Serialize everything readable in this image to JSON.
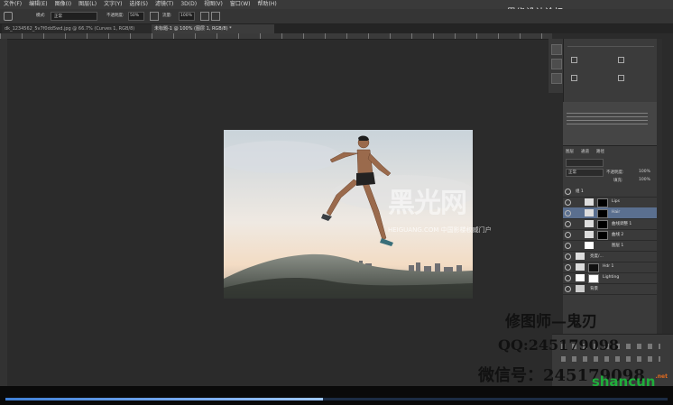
{
  "menu": {
    "items": [
      "文件(F)",
      "编辑(E)",
      "图像(I)",
      "图层(L)",
      "文字(Y)",
      "选择(S)",
      "滤镜(T)",
      "3D(D)",
      "视图(V)",
      "窗口(W)",
      "帮助(H)"
    ]
  },
  "site_watermark": "思缘设计论坛 www.MISSYUAN.COM",
  "options": {
    "mode_value": "正常",
    "opacity_label": "不透明度:",
    "opacity_value": "50%",
    "flow_label": "流量:",
    "flow_value": "100%"
  },
  "tabs": [
    {
      "label": "dk_1234562_5v7f0dd5wd.jpg @ 66.7% (Curves 1, RGB/8)",
      "active": false
    },
    {
      "label": "未标题-1 @ 100% (图层 1, RGB/8) *",
      "active": true
    }
  ],
  "canvas_watermark": {
    "logo": "黑光网",
    "subtitle": "HEIGUANG.COM 中国影楼权威门户"
  },
  "layers": {
    "header_tabs": [
      "图层",
      "通道",
      "路径"
    ],
    "mode_value": "正常",
    "opacity_label": "不透明度:",
    "opacity_value": "100%",
    "fill_label": "填充:",
    "fill_value": "100%",
    "rows": [
      {
        "name": "组 1",
        "selected": false
      },
      {
        "name": "Lips",
        "selected": false
      },
      {
        "name": "Hair",
        "selected": true
      },
      {
        "name": "曲线调整 1",
        "selected": false
      },
      {
        "name": "曲线 2",
        "selected": false
      },
      {
        "name": "图层 1",
        "selected": false
      },
      {
        "name": "亮度/...",
        "selected": false
      },
      {
        "name": "Hdr 1",
        "selected": false
      },
      {
        "name": "Lighting",
        "selected": false
      },
      {
        "name": "背景",
        "selected": false
      }
    ]
  },
  "overlay": {
    "line1": "修图师—鬼刃",
    "line2": "QQ:245179098",
    "line3": "微信号：245179098"
  },
  "progress": 0.48,
  "brand_logo": {
    "text": "shancun",
    "suffix": ".net"
  }
}
